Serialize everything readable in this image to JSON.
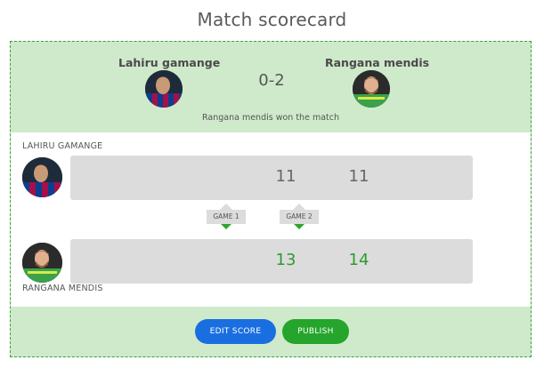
{
  "page": {
    "title": "Match scorecard"
  },
  "match": {
    "player_a": {
      "name": "Lahiru gamange",
      "label": "LAHIRU GAMANGE",
      "avatar": "player-avatar-barcelona-kit"
    },
    "player_b": {
      "name": "Rangana mendis",
      "label": "RANGANA MENDIS",
      "avatar": "player-avatar-goalkeeper-kit"
    },
    "score": "0-2",
    "result": "Rangana mendis won the match",
    "games": [
      {
        "label": "GAME 1",
        "a": "11",
        "b": "13"
      },
      {
        "label": "GAME 2",
        "a": "11",
        "b": "14"
      }
    ]
  },
  "actions": {
    "edit": "EDIT SCORE",
    "publish": "PUBLISH"
  },
  "colors": {
    "card_bg": "#cfeacb",
    "card_border": "#3aa13a",
    "edit_btn": "#1a6fe0",
    "publish_btn": "#25a52b",
    "win_score": "#2f9a2f",
    "bar_bg": "#dcdcdc"
  }
}
